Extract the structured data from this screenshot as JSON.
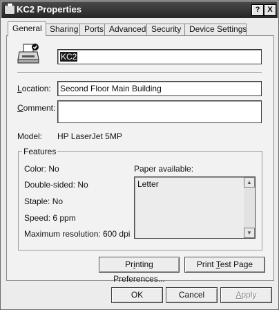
{
  "window": {
    "title": "KC2 Properties",
    "help_glyph": "?",
    "close_glyph": "X"
  },
  "tabs": [
    {
      "label": "General"
    },
    {
      "label": "Sharing"
    },
    {
      "label": "Ports"
    },
    {
      "label": "Advanced"
    },
    {
      "label": "Security"
    },
    {
      "label": "Device Settings"
    }
  ],
  "general": {
    "printer_name": "KC2",
    "location": {
      "label_pre": "",
      "label_accel": "L",
      "label_post": "ocation:",
      "value": "Second Floor Main Building"
    },
    "comment": {
      "label_pre": "",
      "label_accel": "C",
      "label_post": "omment:",
      "value": ""
    },
    "model": {
      "label": "Model:",
      "value": "HP LaserJet 5MP"
    }
  },
  "features": {
    "title": "Features",
    "color": "Color: No",
    "double_sided": "Double-sided: No",
    "staple": "Staple: No",
    "speed": "Speed: 6 ppm",
    "max_resolution": "Maximum resolution: 600 dpi",
    "paper_label": "Paper available:",
    "paper_items": [
      "Letter"
    ]
  },
  "buttons": {
    "printing_prefs": {
      "pre": "Pr",
      "accel": "i",
      "post": "nting Preferences..."
    },
    "print_test": {
      "pre": "Print ",
      "accel": "T",
      "post": "est Page"
    },
    "ok": "OK",
    "cancel": "Cancel",
    "apply": {
      "pre": "",
      "accel": "A",
      "post": "pply"
    }
  }
}
